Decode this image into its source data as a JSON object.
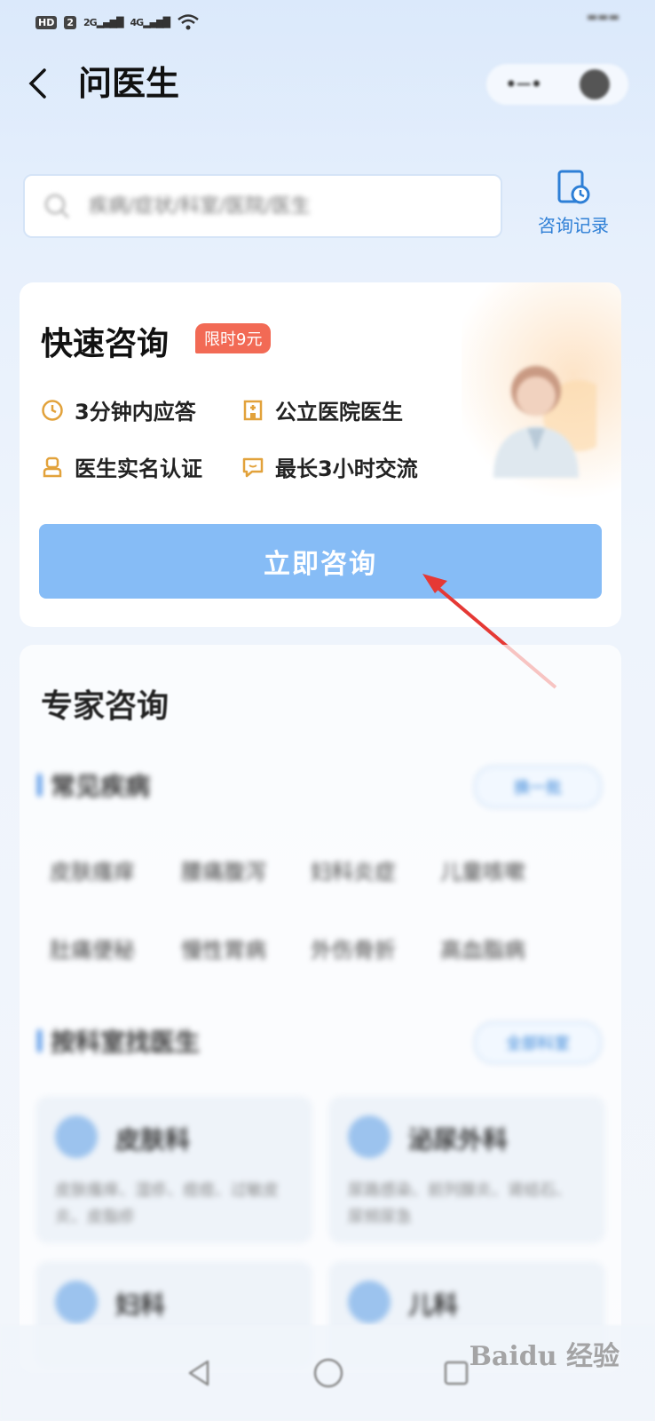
{
  "status_bar": {
    "hd": "HD",
    "sim": "2",
    "net1": "2G",
    "net2": "4G"
  },
  "header": {
    "title": "问医生",
    "back_icon": "chevron-left-icon"
  },
  "search": {
    "placeholder": "疾病/症状/科室/医院/医生"
  },
  "records": {
    "label": "咨询记录",
    "icon": "clock-document-icon"
  },
  "quick_consult": {
    "title": "快速咨询",
    "promo": "限时9元",
    "features": [
      {
        "icon": "clock-icon",
        "label": "3分钟内应答"
      },
      {
        "icon": "hospital-icon",
        "label": "公立医院医生"
      },
      {
        "icon": "id-badge-icon",
        "label": "医生实名认证"
      },
      {
        "icon": "chat-bubble-icon",
        "label": "最长3小时交流"
      }
    ],
    "button": "立即咨询"
  },
  "expert": {
    "title": "专家咨询",
    "common": {
      "heading": "常见疾病",
      "action": "换一批",
      "items": [
        "皮肤瘙痒",
        "腰痛腹泻",
        "妇科炎症",
        "儿童咳嗽",
        "肚痛便秘",
        "慢性胃病",
        "外伤骨折",
        "高血脂病"
      ]
    },
    "departments": {
      "heading": "按科室找医生",
      "action": "全部科室",
      "items": [
        {
          "name": "皮肤科",
          "desc": "皮肤瘙痒、湿疹、痘痘、过敏皮炎、皮脂疹"
        },
        {
          "name": "泌尿外科",
          "desc": "尿路感染、前列腺炎、肾结石、尿频尿急"
        },
        {
          "name": "妇科",
          "desc": ""
        },
        {
          "name": "儿科",
          "desc": ""
        }
      ]
    }
  },
  "watermark": "Baidu 经验",
  "colors": {
    "accent": "#2e7fd6",
    "button": "#86bcf6",
    "promo": "#f26a55",
    "feature_icon": "#e2a23b"
  }
}
